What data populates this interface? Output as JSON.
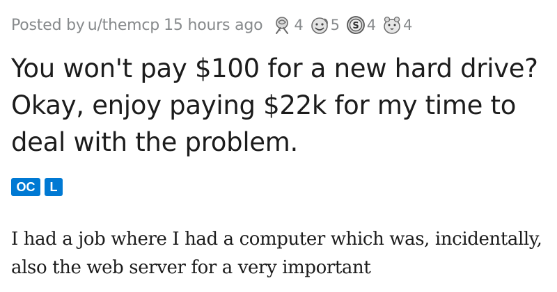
{
  "post": {
    "meta": {
      "posted_prefix": "Posted by",
      "username": "u/themcp",
      "time_ago": "15 hours ago"
    },
    "awards": [
      {
        "icon": "rose-award-icon",
        "count": "4"
      },
      {
        "icon": "smiley-award-icon",
        "count": "5"
      },
      {
        "icon": "coin-award-icon",
        "count": "4"
      },
      {
        "icon": "hamster-award-icon",
        "count": "4"
      }
    ],
    "title": "You won't pay $100 for a new hard drive? Okay, enjoy paying $22k for my time to deal with the problem.",
    "flairs": {
      "oc": "OC",
      "l": "L"
    },
    "body": "I had a job where I had a computer which was, incidentally, also the web server for a very important"
  },
  "colors": {
    "meta_text": "#878a8c",
    "title_text": "#1c1c1c",
    "flair_bg": "#0079d3",
    "flair_text": "#ffffff"
  }
}
